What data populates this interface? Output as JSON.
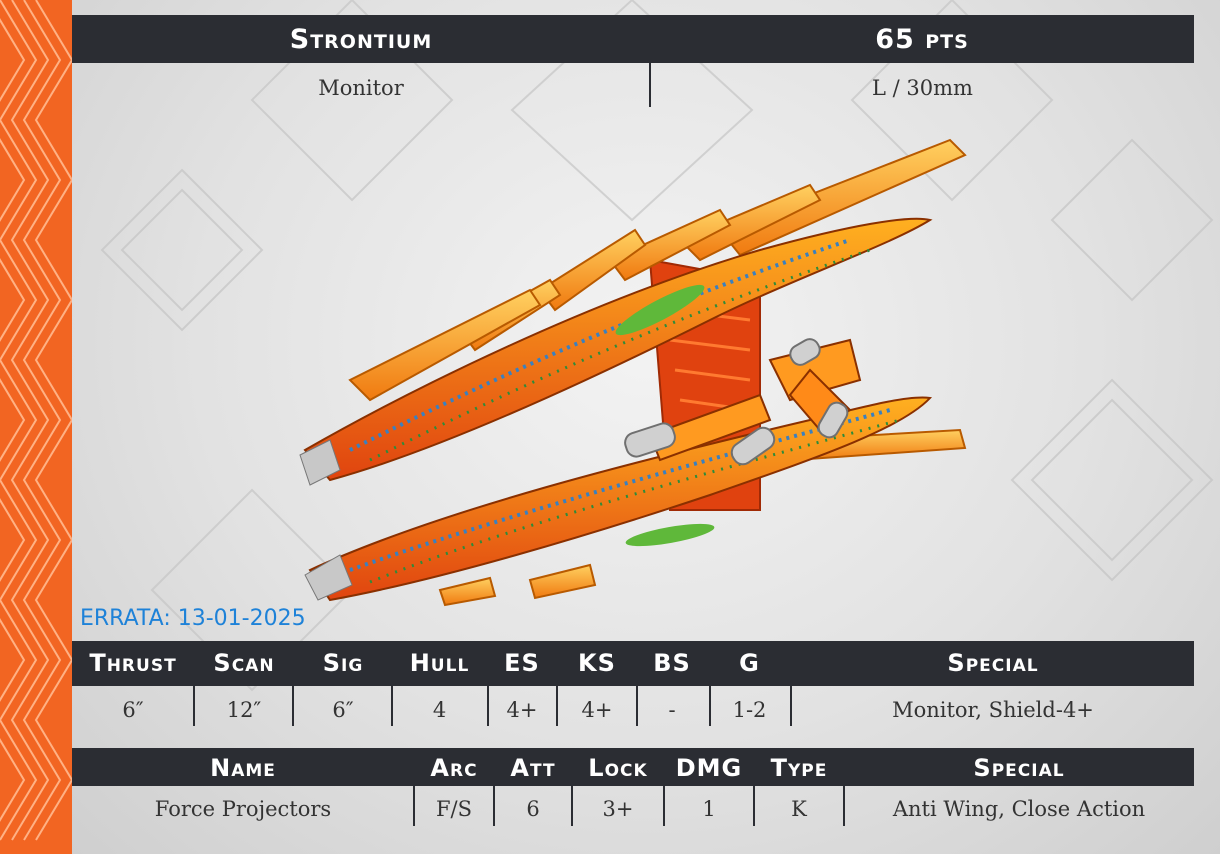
{
  "header": {
    "name": "Strontium",
    "points": "65 pts"
  },
  "subheader": {
    "class": "Monitor",
    "size": "L / 30mm"
  },
  "errata": "ERRATA: 13-01-2025",
  "stats": {
    "headers": [
      "Thrust",
      "Scan",
      "Sig",
      "Hull",
      "ES",
      "KS",
      "BS",
      "G",
      "Special"
    ],
    "values": [
      "6″",
      "12″",
      "6″",
      "4",
      "4+",
      "4+",
      "-",
      "1-2",
      "Monitor, Shield-4+"
    ]
  },
  "weapons": {
    "headers": [
      "Name",
      "Arc",
      "Att",
      "Lock",
      "DMG",
      "Type",
      "Special"
    ],
    "rows": [
      [
        "Force Projectors",
        "F/S",
        "6",
        "3+",
        "1",
        "K",
        "Anti Wing, Close Action"
      ]
    ]
  },
  "colors": {
    "accent": "#f26522",
    "bar": "#2b2d33",
    "errata": "#1e82d8"
  }
}
